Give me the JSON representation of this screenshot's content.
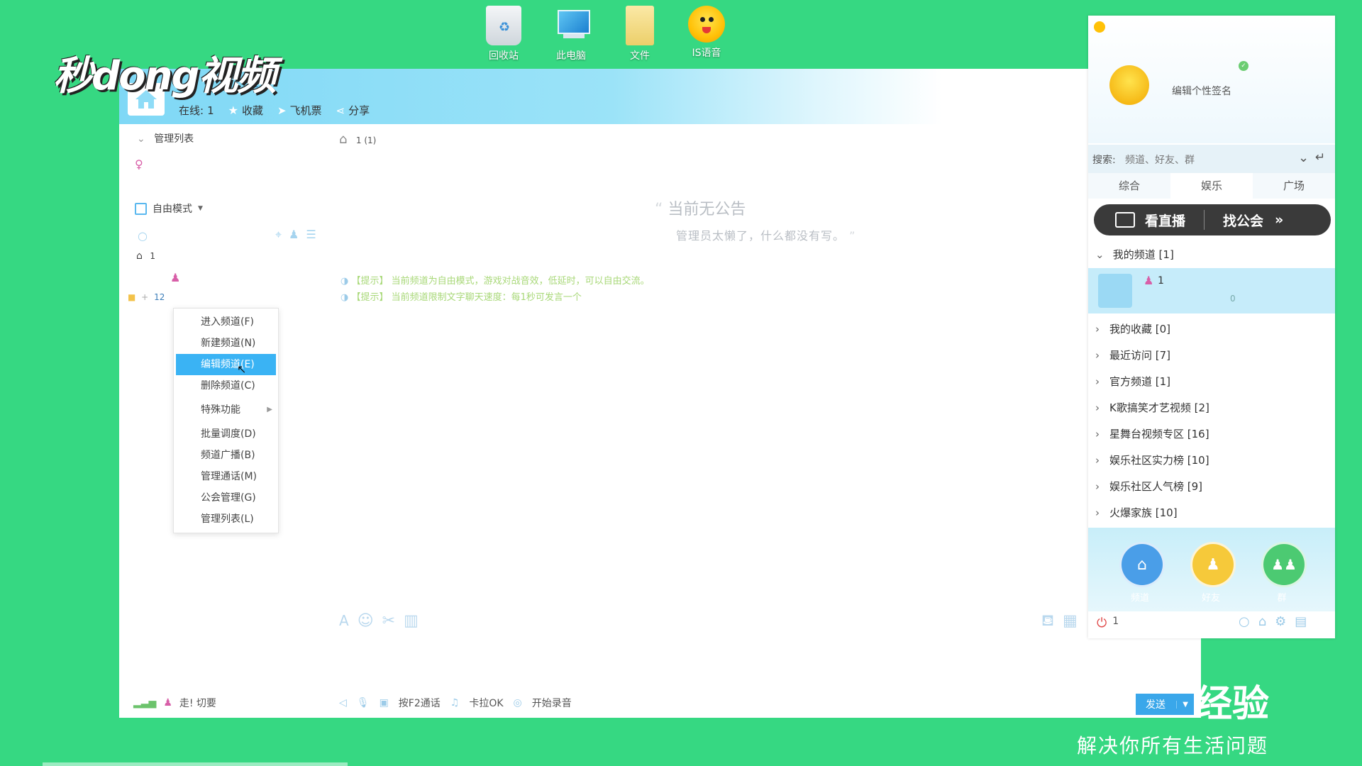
{
  "desktop": {
    "icons": [
      {
        "label": "回收站",
        "icon": "recycle-bin-icon"
      },
      {
        "label": "此电脑",
        "icon": "computer-icon"
      },
      {
        "label": "文件",
        "icon": "folder-icon"
      },
      {
        "label": "IS语音",
        "icon": "is-voice-icon"
      }
    ]
  },
  "watermark": {
    "logo": "秒dong视频",
    "brand": "经验",
    "tagline": "解决你所有生活问题"
  },
  "header": {
    "channel_num": "1",
    "online_label": "在线:",
    "online_count": "1",
    "favorite": "收藏",
    "ticket": "飞机票",
    "share": "分享"
  },
  "left": {
    "manage_list": "管理列表",
    "mode": "自由模式",
    "root_id": "1",
    "sub_channel": "12"
  },
  "context_menu": {
    "items": [
      "进入频道(F)",
      "新建频道(N)",
      "编辑频道(E)",
      "删除频道(C)",
      "特殊功能",
      "批量调度(D)",
      "频道广播(B)",
      "管理通话(M)",
      "公会管理(G)",
      "管理列表(L)"
    ],
    "highlighted_index": 2
  },
  "main": {
    "breadcrumb": "1 (1)",
    "announce_title": "当前无公告",
    "announce_sub": "管理员太懒了，什么都没有写。",
    "tip1": "【提示】 当前频道为自由模式，游戏对战音效，低延时，可以自由交流。",
    "tip2": "【提示】 当前频道限制文字聊天速度：每1秒可发言一个"
  },
  "bottom_bar": {
    "status": "走! 切要",
    "f2_talk": "按F2通话",
    "karaoke": "卡拉OK",
    "record": "开始录音",
    "send": "发送"
  },
  "side": {
    "signature": "编辑个性签名",
    "search_label": "搜索:",
    "search_placeholder": "频道、好友、群",
    "tabs": [
      "综合",
      "娱乐",
      "广场"
    ],
    "banner_left": "看直播",
    "banner_right": "找公会",
    "my_channel": "我的频道 [1]",
    "my_channel_item": "1",
    "my_channel_count": "0",
    "tree": [
      "我的收藏 [0]",
      "最近访问 [7]",
      "官方频道 [1]",
      "K歌搞笑才艺视频 [2]",
      "星舞台视频专区 [16]",
      "娱乐社区实力榜 [10]",
      "娱乐社区人气榜 [9]",
      "火爆家族 [10]"
    ],
    "nav": [
      "频道",
      "好友",
      "群"
    ],
    "power_count": "1"
  },
  "colors": {
    "background": "#36d882",
    "accent": "#3ab3f4",
    "header": "#8fdcf7"
  }
}
